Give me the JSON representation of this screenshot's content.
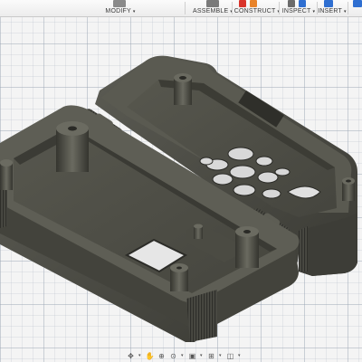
{
  "toolbar": {
    "modify_label": "MODIFY",
    "assemble_label": "ASSEMBLE",
    "construct_label": "CONSTRUCT",
    "inspect_label": "INSPECT",
    "insert_label": "INSERT",
    "caret": "▾"
  },
  "navbar": {
    "icons": [
      "orbit-icon",
      "pan-icon",
      "zoom-icon",
      "fit-icon",
      "display-settings-icon",
      "grid-settings-icon",
      "viewport-icon"
    ]
  },
  "colors": {
    "model_dark": "#3f3f3a",
    "model_mid": "#5a5a52",
    "model_floor": "#4a4a42",
    "grid_line": "#a0a8b4",
    "accent_red": "#d9342b",
    "accent_orange": "#e8832a",
    "accent_blue": "#2f6fd1"
  }
}
